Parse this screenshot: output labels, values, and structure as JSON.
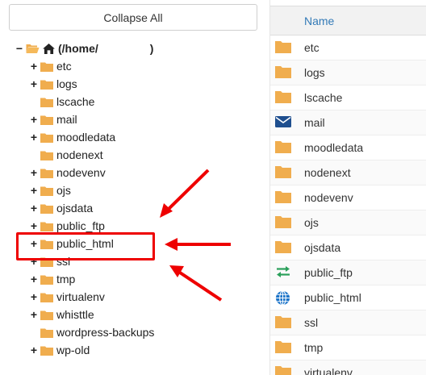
{
  "tree": {
    "collapse_button": "Collapse All",
    "root_label": "(/home/",
    "root_suffix": ")",
    "items": [
      {
        "label": "etc",
        "expandable": true
      },
      {
        "label": "logs",
        "expandable": true
      },
      {
        "label": "lscache",
        "expandable": false
      },
      {
        "label": "mail",
        "expandable": true
      },
      {
        "label": "moodledata",
        "expandable": true
      },
      {
        "label": "nodenext",
        "expandable": false
      },
      {
        "label": "nodevenv",
        "expandable": true
      },
      {
        "label": "ojs",
        "expandable": true
      },
      {
        "label": "ojsdata",
        "expandable": true
      },
      {
        "label": "public_ftp",
        "expandable": true
      },
      {
        "label": "public_html",
        "expandable": true
      },
      {
        "label": "ssl",
        "expandable": true
      },
      {
        "label": "tmp",
        "expandable": true
      },
      {
        "label": "virtualenv",
        "expandable": true
      },
      {
        "label": "whisttle",
        "expandable": true
      },
      {
        "label": "wordpress-backups",
        "expandable": false
      },
      {
        "label": "wp-old",
        "expandable": true
      }
    ]
  },
  "files": {
    "name_header": "Name",
    "rows": [
      {
        "name": "etc",
        "icon": "folder-icon"
      },
      {
        "name": "logs",
        "icon": "folder-icon"
      },
      {
        "name": "lscache",
        "icon": "folder-icon"
      },
      {
        "name": "mail",
        "icon": "mail-icon"
      },
      {
        "name": "moodledata",
        "icon": "folder-icon"
      },
      {
        "name": "nodenext",
        "icon": "folder-icon"
      },
      {
        "name": "nodevenv",
        "icon": "folder-icon"
      },
      {
        "name": "ojs",
        "icon": "folder-icon"
      },
      {
        "name": "ojsdata",
        "icon": "folder-icon"
      },
      {
        "name": "public_ftp",
        "icon": "transfer-icon"
      },
      {
        "name": "public_html",
        "icon": "globe-icon"
      },
      {
        "name": "ssl",
        "icon": "folder-icon"
      },
      {
        "name": "tmp",
        "icon": "folder-icon"
      },
      {
        "name": "virtualenv",
        "icon": "folder-icon"
      }
    ]
  },
  "colors": {
    "folder": "#f0ad4e",
    "annotation": "#ee0000",
    "link": "#337ab7",
    "mail": "#1f4f8f",
    "transfer": "#2aa05a",
    "globe": "#1a73c8"
  }
}
